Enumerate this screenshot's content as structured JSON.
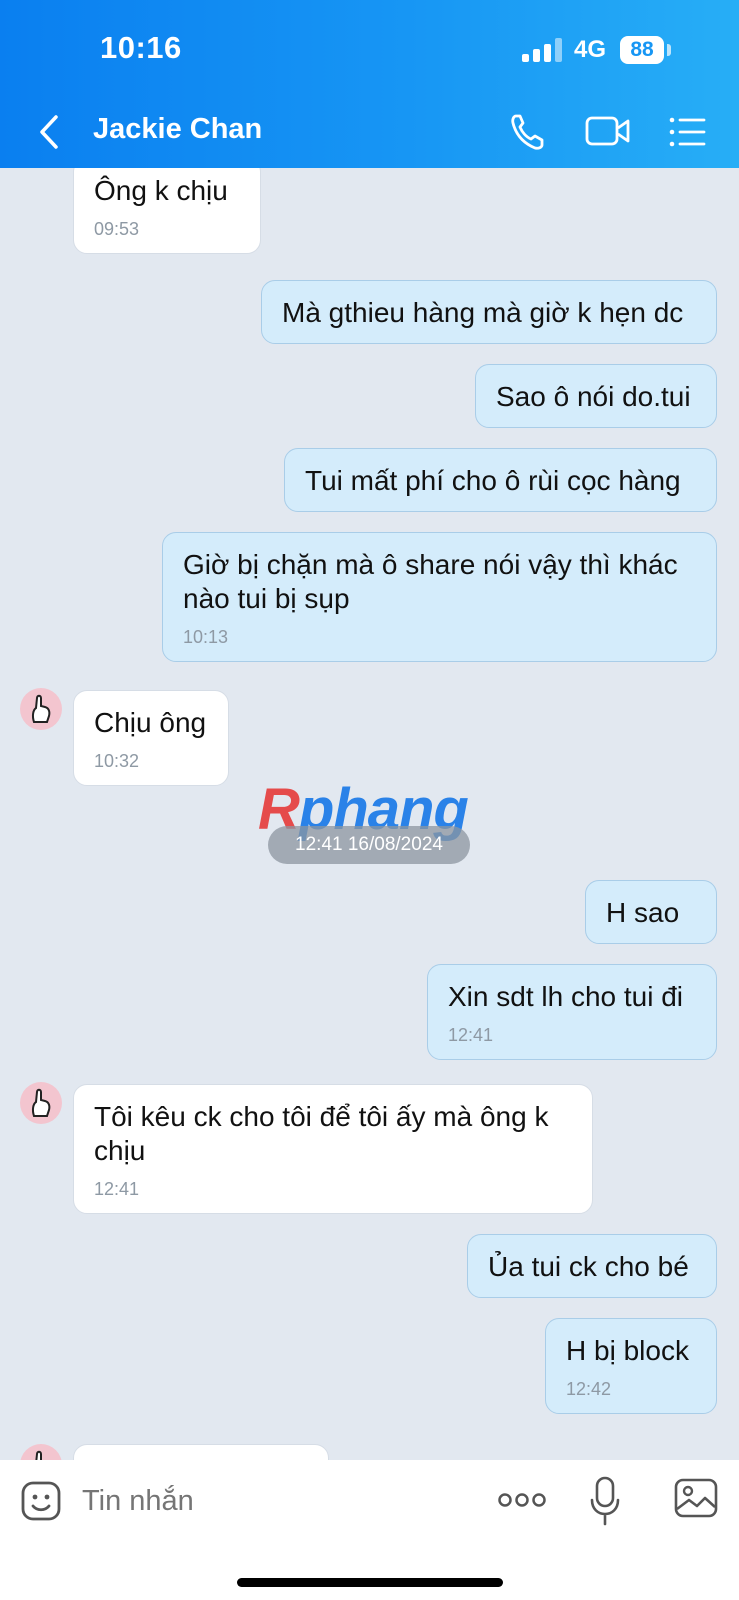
{
  "status_bar": {
    "time": "10:16",
    "network": "4G",
    "battery": "88"
  },
  "header": {
    "contact_name": "Jackie Chan"
  },
  "icons": {
    "back": "chevron-left-icon",
    "call": "phone-icon",
    "video": "video-camera-icon",
    "menu": "list-icon",
    "sticker": "smiley-icon",
    "more": "more-dots-icon",
    "mic": "microphone-icon",
    "image": "image-icon"
  },
  "messages": [
    {
      "text": "Ông k chịu",
      "time": "09:53"
    },
    {
      "text": "Mà gthieu hàng mà giờ k hẹn dc"
    },
    {
      "text": "Sao ô nói do.tui"
    },
    {
      "text": "Tui mất phí cho ô rùi cọc hàng"
    },
    {
      "text": "Giờ bị chặn mà ô share nói vậy thì khác nào tui bị sụp",
      "time": "10:13"
    },
    {
      "text": "Chịu ông",
      "time": "10:32"
    },
    {
      "text": "H sao"
    },
    {
      "text": "Xin sdt lh cho tui đi",
      "time": "12:41"
    },
    {
      "text": "Tôi kêu ck cho tôi để tôi ấy mà ông k chịu",
      "time": "12:41"
    },
    {
      "text": "Ủa tui ck cho bé"
    },
    {
      "text": "H bị block",
      "time": "12:42"
    }
  ],
  "date_separator": "12:41 16/08/2024",
  "watermark": {
    "first": "R",
    "rest": "phang"
  },
  "composer": {
    "placeholder": "Tin nhắn"
  },
  "colors": {
    "header": "#1796f4",
    "outgoing_bubble": "#d4ecfb",
    "incoming_bubble": "#ffffff",
    "chat_bg": "#e2e8f0"
  }
}
